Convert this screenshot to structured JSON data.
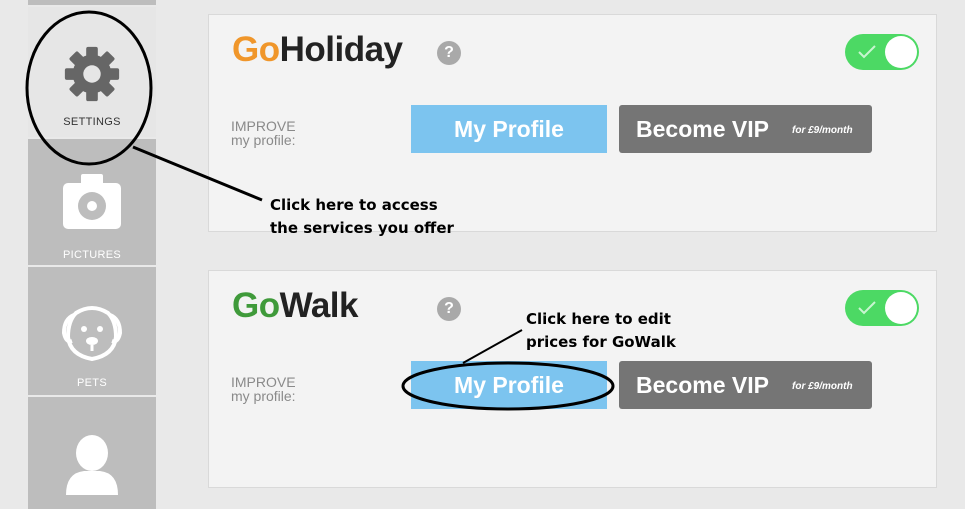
{
  "sidebar": {
    "items": [
      {
        "label": "SETTINGS",
        "icon": "gear-icon"
      },
      {
        "label": "PICTURES",
        "icon": "camera-icon"
      },
      {
        "label": "PETS",
        "icon": "dog-icon"
      },
      {
        "label": "",
        "icon": "user-icon"
      }
    ]
  },
  "cards": [
    {
      "brand_prefix": "Go",
      "brand_suffix": "Holiday",
      "prefix_color": "#f0962a",
      "help": "?",
      "improve_line1": "IMPROVE",
      "improve_line2": "my profile:",
      "profile_button": "My Profile",
      "vip_button": "Become VIP",
      "vip_price": "for £9/month",
      "toggle_on": true
    },
    {
      "brand_prefix": "Go",
      "brand_suffix": "Walk",
      "prefix_color": "#3f9a3a",
      "help": "?",
      "improve_line1": "IMPROVE",
      "improve_line2": "my profile:",
      "profile_button": "My Profile",
      "vip_button": "Become VIP",
      "vip_price": "for £9/month",
      "toggle_on": true
    }
  ],
  "annotations": {
    "settings_note_line1": "Click here to access",
    "settings_note_line2": "the services you offer",
    "profile_note_line1": "Click here to edit",
    "profile_note_line2": "prices for GoWalk"
  },
  "colors": {
    "toggle_green": "#4cd964",
    "profile_blue": "#7cc4ef",
    "vip_gray": "#757575"
  }
}
